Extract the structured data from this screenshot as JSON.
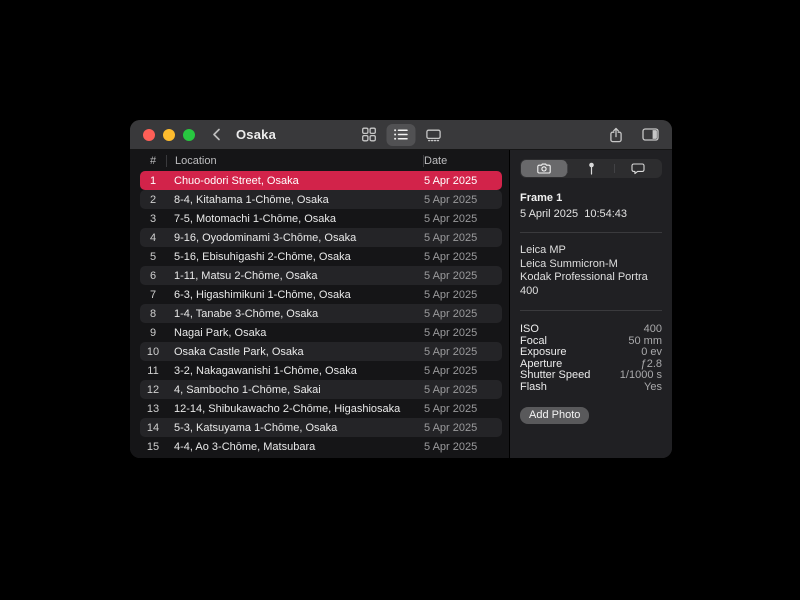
{
  "window": {
    "title": "Osaka"
  },
  "colors": {
    "accent": "#d2234a",
    "traffic_red": "#ff5f57",
    "traffic_yellow": "#febc2e",
    "traffic_green": "#28c840"
  },
  "table": {
    "columns": [
      "#",
      "Location",
      "Date"
    ],
    "rows": [
      {
        "num": "1",
        "location": "Chuo-odori Street, Osaka",
        "date": "5 Apr 2025",
        "selected": true
      },
      {
        "num": "2",
        "location": "8-4, Kitahama 1-Chōme, Osaka",
        "date": "5 Apr 2025"
      },
      {
        "num": "3",
        "location": "7-5, Motomachi 1-Chōme, Osaka",
        "date": "5 Apr 2025"
      },
      {
        "num": "4",
        "location": "9-16, Oyodominami 3-Chōme, Osaka",
        "date": "5 Apr 2025"
      },
      {
        "num": "5",
        "location": "5-16, Ebisuhigashi 2-Chōme, Osaka",
        "date": "5 Apr 2025"
      },
      {
        "num": "6",
        "location": "1-11, Matsu 2-Chōme, Osaka",
        "date": "5 Apr 2025"
      },
      {
        "num": "7",
        "location": "6-3, Higashimikuni 1-Chōme, Osaka",
        "date": "5 Apr 2025"
      },
      {
        "num": "8",
        "location": "1-4, Tanabe 3-Chōme, Osaka",
        "date": "5 Apr 2025"
      },
      {
        "num": "9",
        "location": "Nagai Park, Osaka",
        "date": "5 Apr 2025"
      },
      {
        "num": "10",
        "location": "Osaka Castle Park, Osaka",
        "date": "5 Apr 2025"
      },
      {
        "num": "11",
        "location": "3-2, Nakagawanishi 1-Chōme, Osaka",
        "date": "5 Apr 2025"
      },
      {
        "num": "12",
        "location": "4, Sambocho 1-Chōme, Sakai",
        "date": "5 Apr 2025"
      },
      {
        "num": "13",
        "location": "12-14, Shibukawacho 2-Chōme, Higashiosaka",
        "date": "5 Apr 2025"
      },
      {
        "num": "14",
        "location": "5-3, Katsuyama 1-Chōme, Osaka",
        "date": "5 Apr 2025"
      },
      {
        "num": "15",
        "location": "4-4, Ao 3-Chōme, Matsubara",
        "date": "5 Apr 2025"
      }
    ]
  },
  "inspector": {
    "tabs": [
      {
        "icon": "camera",
        "selected": true
      },
      {
        "icon": "pin",
        "selected": false
      },
      {
        "icon": "comment",
        "selected": false
      }
    ],
    "frame_title": "Frame 1",
    "frame_datetime": "5 April 2025  10:54:43",
    "equipment": [
      "Leica MP",
      "Leica Summicron-M",
      "Kodak Professional Portra 400"
    ],
    "details": [
      {
        "label": "ISO",
        "value": "400"
      },
      {
        "label": "Focal",
        "value": "50 mm"
      },
      {
        "label": "Exposure",
        "value": "0 ev"
      },
      {
        "label": "Aperture",
        "value": "ƒ2.8"
      },
      {
        "label": "Shutter Speed",
        "value": "1/1000 s"
      },
      {
        "label": "Flash",
        "value": "Yes"
      }
    ],
    "add_photo_label": "Add Photo"
  }
}
